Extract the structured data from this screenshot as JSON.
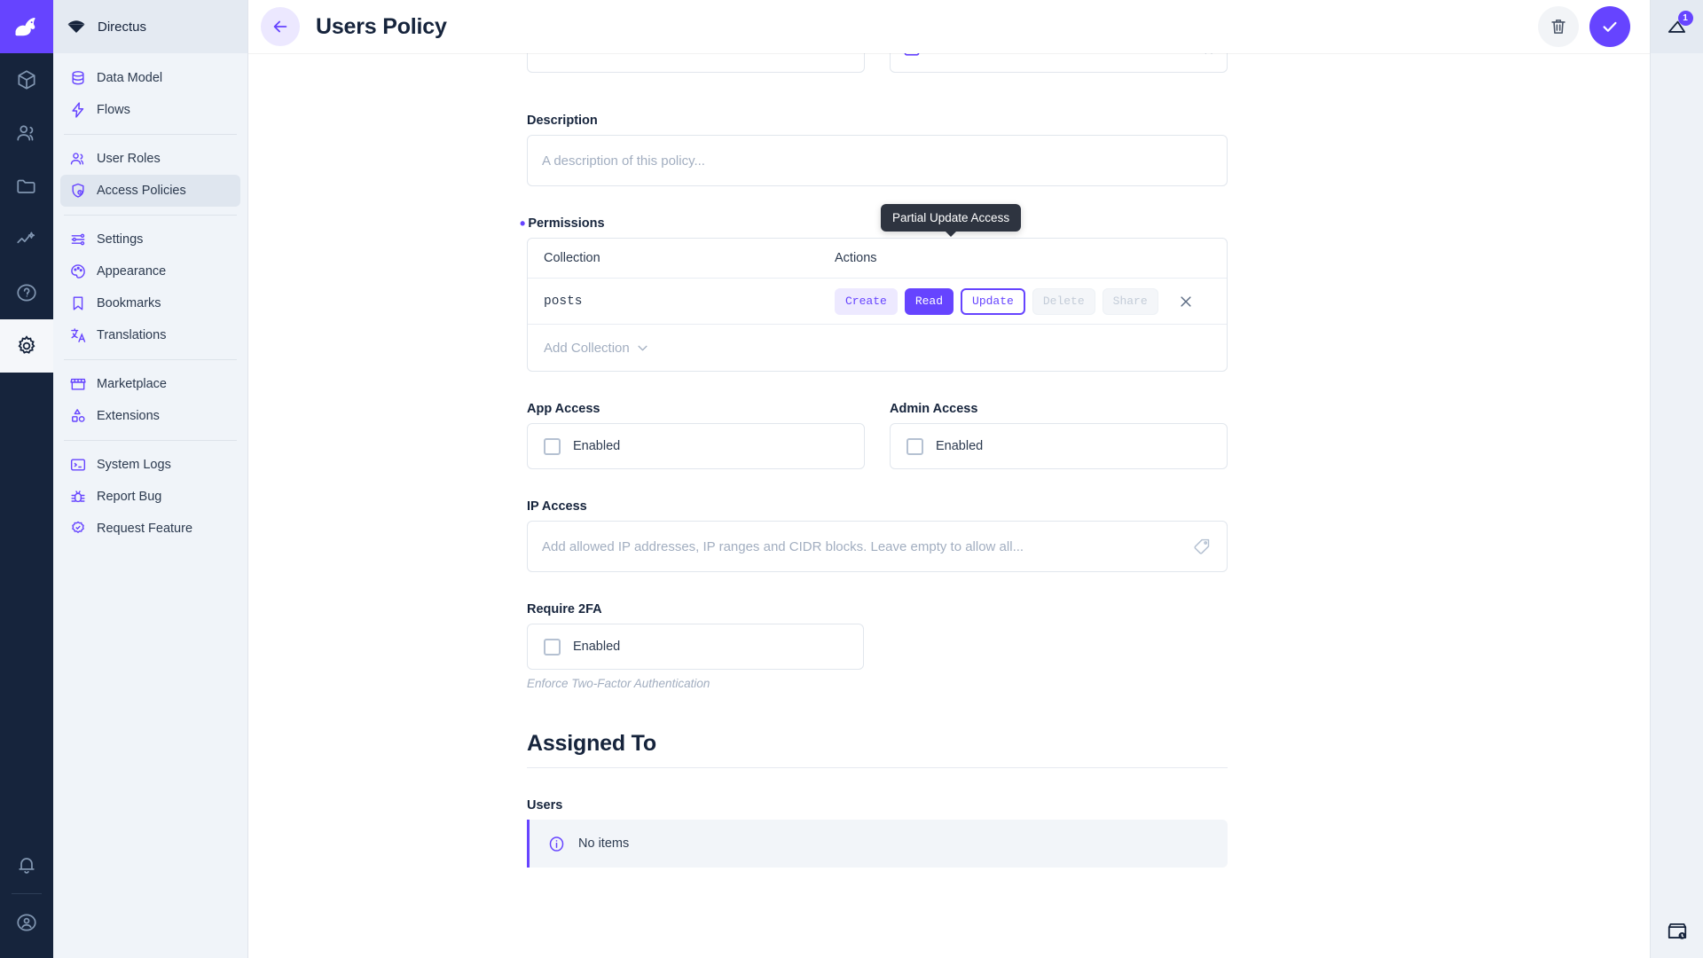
{
  "brand": {
    "name": "Directus",
    "logo_icon": "directus-rabbit-logo",
    "mark_icon": "directus-diamond-mark"
  },
  "module_bar": {
    "items": [
      {
        "name": "content",
        "icon": "box-icon",
        "active": false
      },
      {
        "name": "users",
        "icon": "people-icon",
        "active": false
      },
      {
        "name": "files",
        "icon": "folder-icon",
        "active": false
      },
      {
        "name": "insights",
        "icon": "analytics-icon",
        "active": false
      },
      {
        "name": "docs",
        "icon": "question-mark-icon",
        "active": false
      },
      {
        "name": "settings",
        "icon": "gear-icon",
        "active": true
      }
    ],
    "bottom": [
      {
        "name": "notifications",
        "icon": "bell-icon"
      },
      {
        "name": "account",
        "icon": "user-circle-icon"
      }
    ]
  },
  "sidebar": {
    "groups": [
      {
        "items": [
          {
            "label": "Data Model",
            "icon": "database-icon",
            "active": false
          },
          {
            "label": "Flows",
            "icon": "bolt-icon",
            "active": false
          }
        ]
      },
      {
        "items": [
          {
            "label": "User Roles",
            "icon": "people-icon",
            "active": false
          },
          {
            "label": "Access Policies",
            "icon": "shield-badge-icon",
            "active": true
          }
        ]
      },
      {
        "items": [
          {
            "label": "Settings",
            "icon": "sliders-icon",
            "active": false
          },
          {
            "label": "Appearance",
            "icon": "palette-icon",
            "active": false
          },
          {
            "label": "Bookmarks",
            "icon": "bookmark-icon",
            "active": false
          },
          {
            "label": "Translations",
            "icon": "translate-icon",
            "active": false
          }
        ]
      },
      {
        "items": [
          {
            "label": "Marketplace",
            "icon": "storefront-icon",
            "active": false
          },
          {
            "label": "Extensions",
            "icon": "shapes-icon",
            "active": false
          }
        ]
      },
      {
        "items": [
          {
            "label": "System Logs",
            "icon": "terminal-icon",
            "active": false
          },
          {
            "label": "Report Bug",
            "icon": "bug-icon",
            "active": false
          },
          {
            "label": "Request Feature",
            "icon": "badge-check-icon",
            "active": false
          }
        ]
      }
    ]
  },
  "header": {
    "title": "Users Policy",
    "back_icon": "arrow-left-icon",
    "delete_icon": "trash-icon",
    "save_icon": "check-icon"
  },
  "form": {
    "description": {
      "label": "Description",
      "value": "",
      "placeholder": "A description of this policy..."
    },
    "permissions": {
      "label": "Permissions",
      "required": true,
      "columns": {
        "collection": "Collection",
        "actions": "Actions"
      },
      "rows": [
        {
          "collection": "posts",
          "remove_icon": "close-icon",
          "actions": [
            {
              "label": "Create",
              "state": "partial"
            },
            {
              "label": "Read",
              "state": "full"
            },
            {
              "label": "Update",
              "state": "outline"
            },
            {
              "label": "Delete",
              "state": "none"
            },
            {
              "label": "Share",
              "state": "none"
            }
          ]
        }
      ],
      "add_label": "Add Collection",
      "add_icon": "chevron-down-icon",
      "tooltip": "Partial Update Access"
    },
    "app_access": {
      "label": "App Access",
      "checkbox_label": "Enabled",
      "checked": false
    },
    "admin_access": {
      "label": "Admin Access",
      "checkbox_label": "Enabled",
      "checked": false
    },
    "ip_access": {
      "label": "IP Access",
      "value": "",
      "placeholder": "Add allowed IP addresses, IP ranges and CIDR blocks. Leave empty to allow all...",
      "icon": "tag-icon"
    },
    "require_2fa": {
      "label": "Require 2FA",
      "checkbox_label": "Enabled",
      "checked": false,
      "hint": "Enforce Two-Factor Authentication"
    }
  },
  "assigned_to": {
    "title": "Assigned To",
    "users": {
      "label": "Users",
      "empty_text": "No items",
      "info_icon": "info-circle-icon"
    }
  },
  "right_rail": {
    "revisions": {
      "icon": "revisions-icon",
      "badge": "1"
    },
    "history": {
      "icon": "archive-clock-icon"
    }
  },
  "colors": {
    "accent": "#6644ff",
    "accent_soft": "#ede9ff",
    "dark_navy": "#16243c",
    "sidebar_bg": "#f0f4f9",
    "tooltip_bg": "#2e3440",
    "muted_text": "#a2aec0",
    "border": "#e1e6ed"
  }
}
